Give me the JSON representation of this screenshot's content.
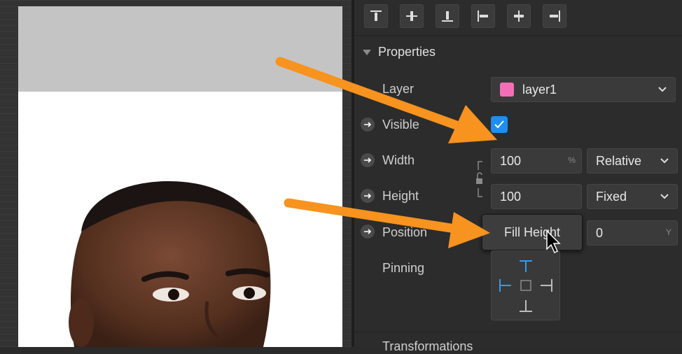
{
  "inspector": {
    "section_title": "Properties",
    "labels": {
      "layer": "Layer",
      "visible": "Visible",
      "width": "Width",
      "height": "Height",
      "position": "Position",
      "pinning": "Pinning"
    },
    "layer_value": "layer1",
    "layer_color": "#f26fb8",
    "visible_checked": true,
    "width_value": "100",
    "width_unit": "%",
    "width_mode": "Relative",
    "height_value": "100",
    "height_mode": "Fixed",
    "fill_height_button": "Fill Height",
    "position_y_value": "0",
    "position_y_unit": "Y",
    "next_section_title": "Transformations"
  },
  "align_icons": [
    "align-top-icon",
    "align-middle-icon",
    "align-bottom-icon",
    "align-left-icon",
    "align-center-icon",
    "align-right-icon"
  ],
  "colors": {
    "accent": "#1e8ef0",
    "arrow": "#f7931e",
    "panel": "#2c2c2c"
  }
}
